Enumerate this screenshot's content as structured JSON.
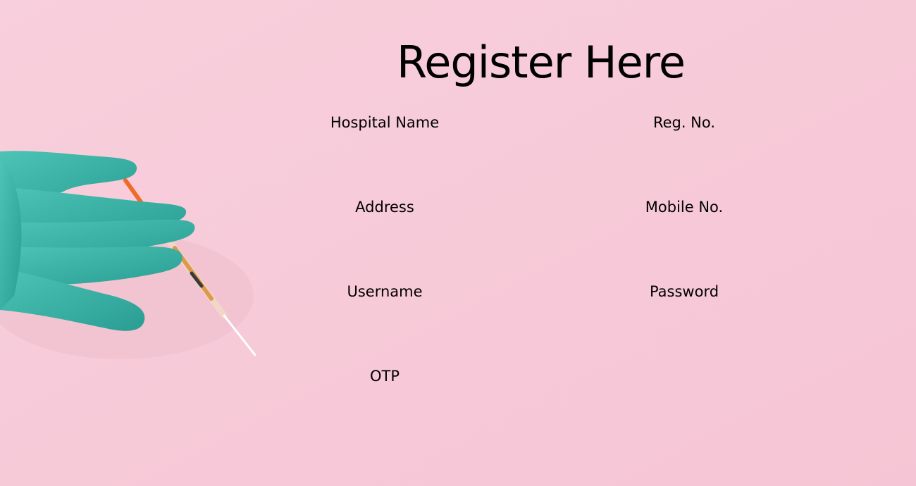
{
  "page": {
    "title": "Register Here"
  },
  "form": {
    "fields": {
      "hospital_name": {
        "label": "Hospital Name",
        "value": ""
      },
      "reg_no": {
        "label": "Reg. No.",
        "value": ""
      },
      "address": {
        "label": "Address",
        "value": ""
      },
      "mobile_no": {
        "label": "Mobile No.",
        "value": ""
      },
      "username": {
        "label": "Username",
        "value": ""
      },
      "password": {
        "label": "Password",
        "value": ""
      },
      "otp": {
        "label": "OTP",
        "value": ""
      }
    }
  },
  "colors": {
    "background": "#f7cad9",
    "glove": "#3bb3a6",
    "syringe_plunger": "#f06a2a",
    "text": "#000000"
  }
}
